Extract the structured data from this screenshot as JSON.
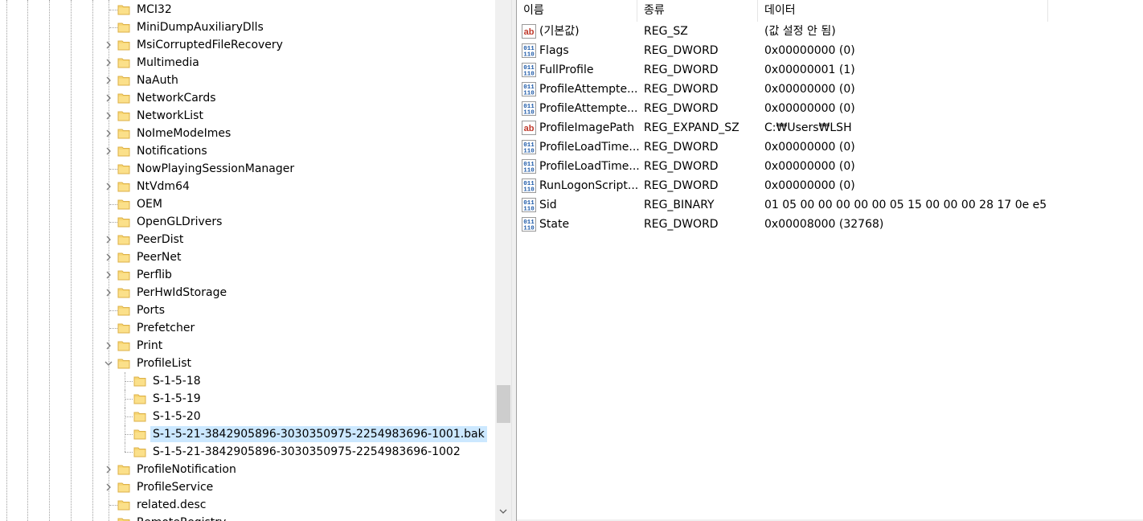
{
  "tree": {
    "items": [
      {
        "label": "MCI32",
        "level": 1,
        "expander": "none"
      },
      {
        "label": "MiniDumpAuxiliaryDlls",
        "level": 1,
        "expander": "none"
      },
      {
        "label": "MsiCorruptedFileRecovery",
        "level": 1,
        "expander": "collapsed"
      },
      {
        "label": "Multimedia",
        "level": 1,
        "expander": "collapsed"
      },
      {
        "label": "NaAuth",
        "level": 1,
        "expander": "collapsed"
      },
      {
        "label": "NetworkCards",
        "level": 1,
        "expander": "collapsed"
      },
      {
        "label": "NetworkList",
        "level": 1,
        "expander": "collapsed"
      },
      {
        "label": "NoImeModeImes",
        "level": 1,
        "expander": "collapsed"
      },
      {
        "label": "Notifications",
        "level": 1,
        "expander": "collapsed"
      },
      {
        "label": "NowPlayingSessionManager",
        "level": 1,
        "expander": "none"
      },
      {
        "label": "NtVdm64",
        "level": 1,
        "expander": "collapsed"
      },
      {
        "label": "OEM",
        "level": 1,
        "expander": "none"
      },
      {
        "label": "OpenGLDrivers",
        "level": 1,
        "expander": "none"
      },
      {
        "label": "PeerDist",
        "level": 1,
        "expander": "collapsed"
      },
      {
        "label": "PeerNet",
        "level": 1,
        "expander": "collapsed"
      },
      {
        "label": "Perflib",
        "level": 1,
        "expander": "collapsed"
      },
      {
        "label": "PerHwIdStorage",
        "level": 1,
        "expander": "collapsed"
      },
      {
        "label": "Ports",
        "level": 1,
        "expander": "none"
      },
      {
        "label": "Prefetcher",
        "level": 1,
        "expander": "none"
      },
      {
        "label": "Print",
        "level": 1,
        "expander": "collapsed"
      },
      {
        "label": "ProfileList",
        "level": 1,
        "expander": "expanded"
      },
      {
        "label": "S-1-5-18",
        "level": 2,
        "expander": "none"
      },
      {
        "label": "S-1-5-19",
        "level": 2,
        "expander": "none"
      },
      {
        "label": "S-1-5-20",
        "level": 2,
        "expander": "none"
      },
      {
        "label": "S-1-5-21-3842905896-3030350975-2254983696-1001.bak",
        "level": 2,
        "expander": "none",
        "selected": true
      },
      {
        "label": "S-1-5-21-3842905896-3030350975-2254983696-1002",
        "level": 2,
        "expander": "none"
      },
      {
        "label": "ProfileNotification",
        "level": 1,
        "expander": "collapsed"
      },
      {
        "label": "ProfileService",
        "level": 1,
        "expander": "collapsed"
      },
      {
        "label": "related.desc",
        "level": 1,
        "expander": "none"
      },
      {
        "label": "RemoteRegistry",
        "level": 1,
        "expander": "none"
      }
    ]
  },
  "values": {
    "columns": {
      "name": "이름",
      "type": "종류",
      "data": "데이터"
    },
    "rows": [
      {
        "icon": "string-value-icon",
        "name": "(기본값)",
        "type": "REG_SZ",
        "data": "(값 설정 안 됨)"
      },
      {
        "icon": "binary-value-icon",
        "name": "Flags",
        "type": "REG_DWORD",
        "data": "0x00000000 (0)"
      },
      {
        "icon": "binary-value-icon",
        "name": "FullProfile",
        "type": "REG_DWORD",
        "data": "0x00000001 (1)"
      },
      {
        "icon": "binary-value-icon",
        "name": "ProfileAttempte...",
        "type": "REG_DWORD",
        "data": "0x00000000 (0)"
      },
      {
        "icon": "binary-value-icon",
        "name": "ProfileAttempte...",
        "type": "REG_DWORD",
        "data": "0x00000000 (0)"
      },
      {
        "icon": "string-value-icon",
        "name": "ProfileImagePath",
        "type": "REG_EXPAND_SZ",
        "data": "C:₩Users₩LSH"
      },
      {
        "icon": "binary-value-icon",
        "name": "ProfileLoadTime...",
        "type": "REG_DWORD",
        "data": "0x00000000 (0)"
      },
      {
        "icon": "binary-value-icon",
        "name": "ProfileLoadTime...",
        "type": "REG_DWORD",
        "data": "0x00000000 (0)"
      },
      {
        "icon": "binary-value-icon",
        "name": "RunLogonScript...",
        "type": "REG_DWORD",
        "data": "0x00000000 (0)"
      },
      {
        "icon": "binary-value-icon",
        "name": "Sid",
        "type": "REG_BINARY",
        "data": "01 05 00 00 00 00 00 05 15 00 00 00 28 17 0e e5 ..."
      },
      {
        "icon": "binary-value-icon",
        "name": "State",
        "type": "REG_DWORD",
        "data": "0x00008000 (32768)"
      }
    ]
  },
  "colors": {
    "selection": "#cce8ff",
    "folder": "#f8d775",
    "folder_edge": "#dcb048",
    "binary_icon": "#1e5aa8",
    "string_icon": "#c0392b"
  }
}
